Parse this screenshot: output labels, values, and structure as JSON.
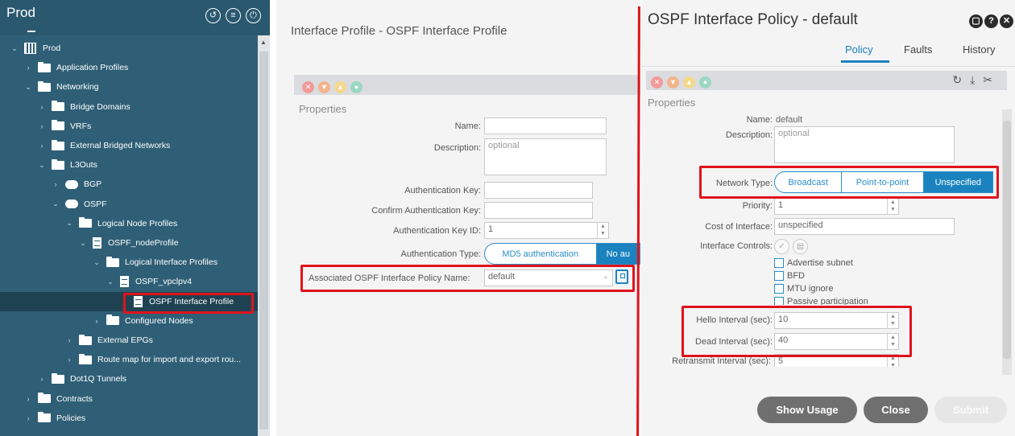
{
  "sidebar": {
    "title": "Prod",
    "header_icons": [
      "clock-icon",
      "list-icon",
      "power-icon"
    ],
    "tree": [
      {
        "label": "Prod",
        "icon": "tenant-icon",
        "caret": "down",
        "indent": 0
      },
      {
        "label": "Application Profiles",
        "icon": "folder-icon",
        "caret": "right",
        "indent": 1
      },
      {
        "label": "Networking",
        "icon": "folder-icon",
        "caret": "down",
        "indent": 1
      },
      {
        "label": "Bridge Domains",
        "icon": "folder-icon",
        "caret": "right",
        "indent": 2
      },
      {
        "label": "VRFs",
        "icon": "folder-icon",
        "caret": "right",
        "indent": 2
      },
      {
        "label": "External Bridged Networks",
        "icon": "folder-icon",
        "caret": "right",
        "indent": 2
      },
      {
        "label": "L3Outs",
        "icon": "folder-icon",
        "caret": "down",
        "indent": 2
      },
      {
        "label": "BGP",
        "icon": "cloud-icon",
        "caret": "right",
        "indent": 3
      },
      {
        "label": "OSPF",
        "icon": "cloud-icon",
        "caret": "down",
        "indent": 3
      },
      {
        "label": "Logical Node Profiles",
        "icon": "folder-icon",
        "caret": "down",
        "indent": 4
      },
      {
        "label": "OSPF_nodeProfile",
        "icon": "document-icon",
        "caret": "down",
        "indent": 5
      },
      {
        "label": "Logical Interface Profiles",
        "icon": "folder-icon",
        "caret": "down",
        "indent": 6
      },
      {
        "label": "OSPF_vpclpv4",
        "icon": "document-icon",
        "caret": "down",
        "indent": 7
      },
      {
        "label": "OSPF Interface Profile",
        "icon": "document-icon",
        "caret": "",
        "indent": 8,
        "selected": true
      },
      {
        "label": "Configured Nodes",
        "icon": "folder-icon",
        "caret": "right",
        "indent": 6
      },
      {
        "label": "External EPGs",
        "icon": "folder-icon",
        "caret": "right",
        "indent": 4
      },
      {
        "label": "Route map for import and export rou...",
        "icon": "folder-icon",
        "caret": "right",
        "indent": 4
      },
      {
        "label": "Dot1Q Tunnels",
        "icon": "folder-icon",
        "caret": "right",
        "indent": 2
      },
      {
        "label": "Contracts",
        "icon": "folder-icon",
        "caret": "right",
        "indent": 1
      },
      {
        "label": "Policies",
        "icon": "folder-icon",
        "caret": "right",
        "indent": 1
      }
    ]
  },
  "middle": {
    "title": "Interface Profile - OSPF Interface Profile",
    "properties_label": "Properties",
    "name_label": "Name:",
    "name_value": "",
    "description_label": "Description:",
    "description_placeholder": "optional",
    "auth_key_label": "Authentication Key:",
    "confirm_auth_key_label": "Confirm Authentication Key:",
    "auth_key_id_label": "Authentication Key ID:",
    "auth_key_id_value": "1",
    "auth_type_label": "Authentication Type:",
    "auth_type_options": [
      "MD5 authentication",
      "No au"
    ],
    "policy_name_label": "Associated OSPF Interface Policy Name:",
    "policy_name_value": "default"
  },
  "right": {
    "title": "OSPF Interface Policy - default",
    "tabs": [
      "Policy",
      "Faults",
      "History"
    ],
    "active_tab": "Policy",
    "properties_label": "Properties",
    "name_label": "Name:",
    "name_value": "default",
    "description_label": "Description:",
    "description_placeholder": "optional",
    "network_type_label": "Network Type:",
    "network_type_options": [
      "Broadcast",
      "Point-to-point",
      "Unspecified"
    ],
    "network_type_selected": "Unspecified",
    "priority_label": "Priority:",
    "priority_value": "1",
    "cost_label": "Cost of Interface:",
    "cost_value": "unspecified",
    "controls_label": "Interface Controls:",
    "controls": [
      "Advertise subnet",
      "BFD",
      "MTU ignore",
      "Passive participation"
    ],
    "hello_label": "Hello Interval (sec):",
    "hello_value": "10",
    "dead_label": "Dead Interval (sec):",
    "dead_value": "40",
    "retransmit_label": "Retransmit Interval (sec):",
    "retransmit_value": "5",
    "buttons": {
      "show_usage": "Show Usage",
      "close": "Close",
      "submit": "Submit"
    }
  },
  "colors": {
    "sidebar_bg": "#2f5f76",
    "accent": "#1a83bf",
    "highlight": "#e0131b"
  }
}
